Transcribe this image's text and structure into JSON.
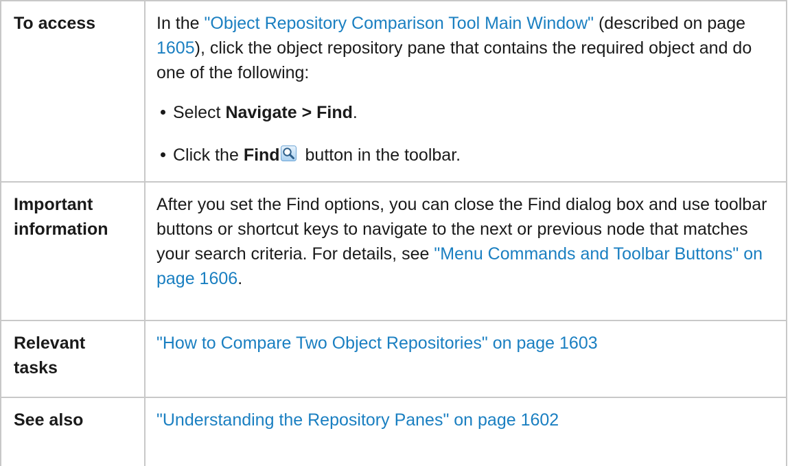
{
  "rows": {
    "access": {
      "label": "To access",
      "intro_prefix": "In the ",
      "intro_link": "\"Object Repository Comparison Tool Main Window\"",
      "intro_mid": " (described on page ",
      "intro_page_link": "1605",
      "intro_suffix": "), click the object repository pane that contains the required object and do one of the following:",
      "bullet1_prefix": "Select ",
      "bullet1_bold": "Navigate > Find",
      "bullet1_suffix": ".",
      "bullet2_prefix": "Click the ",
      "bullet2_bold": "Find",
      "bullet2_icon": "magnifier-icon",
      "bullet2_suffix": " button in the toolbar."
    },
    "important": {
      "label_line1": "Important",
      "label_line2": "information",
      "text": "After you set the Find options, you can close the Find dialog box and use toolbar buttons or shortcut keys to navigate to the next or previous node that matches your search criteria. For details, see ",
      "link": "\"Menu Commands and Toolbar Buttons\" on page 1606",
      "suffix": "."
    },
    "tasks": {
      "label_line1": "Relevant",
      "label_line2": "tasks",
      "link": "\"How to Compare Two Object Repositories\" on page 1603"
    },
    "see_also": {
      "label": "See also",
      "link": "\"Understanding the Repository Panes\" on page 1602"
    }
  },
  "colors": {
    "link": "#1a7fc1",
    "border": "#c8c8c8",
    "text": "#1a1a1a"
  }
}
